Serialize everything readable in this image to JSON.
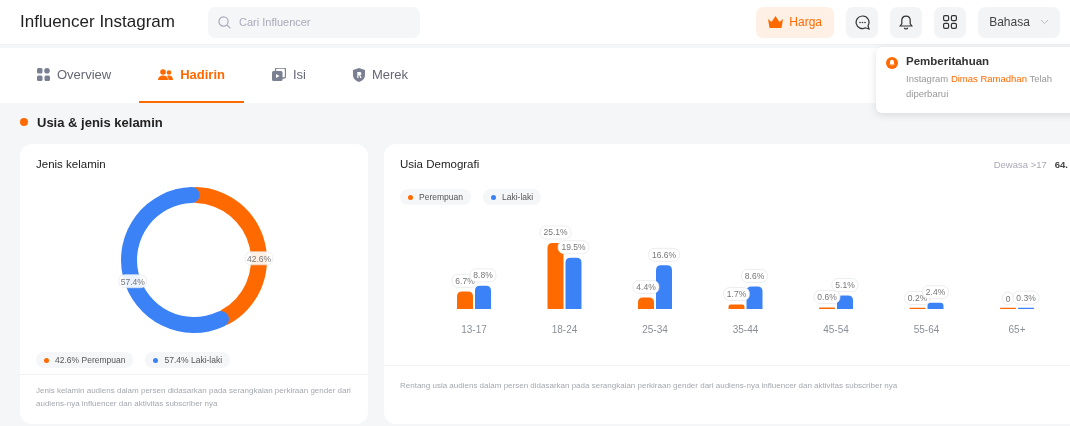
{
  "header": {
    "title": "Influencer Instagram",
    "search": {
      "placeholder": "Cari Influencer"
    },
    "pricing_button": "Harga",
    "language_select": "Bahasa"
  },
  "tabs": [
    {
      "label": "Overview",
      "selected": false
    },
    {
      "label": "Hadirin",
      "selected": true
    },
    {
      "label": "Isi",
      "selected": false
    },
    {
      "label": "Merek",
      "selected": false
    }
  ],
  "notification": {
    "title": "Pemberitahuan",
    "text_before": "Instagram",
    "link": "Dimas Ramadhan",
    "text_after": "Telah diperbarui"
  },
  "section": {
    "title": "Usia & jenis kelamin"
  },
  "gender_card": {
    "title": "Jenis kelamin",
    "chart_data": {
      "type": "donut",
      "categories": [
        "Perempuan",
        "Laki-laki"
      ],
      "values": [
        42.6,
        57.4
      ],
      "value_labels": [
        "42.6%",
        "57.4%"
      ]
    },
    "legend": [
      {
        "color": "#ff6a00"
      },
      {
        "color": "#3b82f6"
      }
    ],
    "note": "Jenis kelamin audiens dalam persen didasarkan pada serangkaian perkiraan gender dari audiens-nya influencer dan aktivitas subscriber nya"
  },
  "age_card": {
    "title": "Usia Demografi",
    "summary_label": "Dewasa >17",
    "summary_value": "64.",
    "chart_data": {
      "type": "bar",
      "categories": [
        "13-17",
        "18-24",
        "25-34",
        "35-44",
        "45-54",
        "55-64",
        "65+"
      ],
      "series": [
        {
          "name": "Perempuan",
          "color": "#ff6a00",
          "values": [
            6.7,
            25.1,
            4.4,
            1.7,
            0.6,
            0.2,
            0
          ],
          "value_labels": [
            "6.7%",
            "25.1%",
            "4.4%",
            "1.7%",
            "0.6%",
            "0.2%",
            "0"
          ]
        },
        {
          "name": "Laki-laki",
          "color": "#3b82f6",
          "values": [
            8.8,
            19.5,
            16.6,
            8.6,
            5.1,
            2.4,
            0.3
          ],
          "value_labels": [
            "8.8%",
            "19.5%",
            "16.6%",
            "8.6%",
            "5.1%",
            "2.4%",
            "0.3%"
          ]
        }
      ]
    },
    "note": "Rentang usia audiens dalam persen didasarkan pada serangkaian perkiraan gender dari audiens-nya influencer dan aktivitas subscriber nya"
  }
}
